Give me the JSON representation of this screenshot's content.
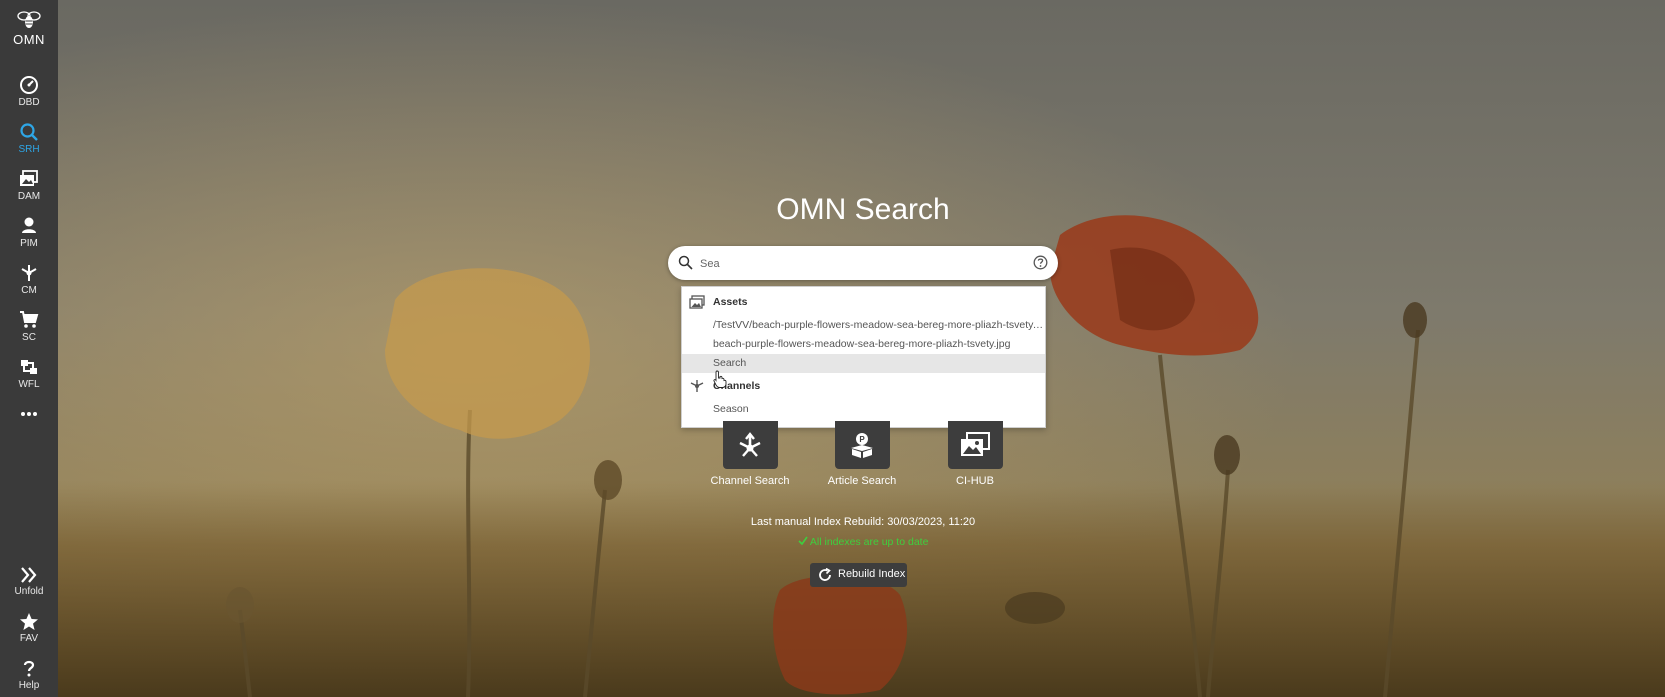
{
  "sidebar": {
    "logo_text": "OMN",
    "items": [
      {
        "icon": "dashboard-icon",
        "label": "DBD"
      },
      {
        "icon": "search-icon",
        "label": "SRH",
        "active": true
      },
      {
        "icon": "image-gallery-icon",
        "label": "DAM"
      },
      {
        "icon": "product-icon",
        "label": "PIM"
      },
      {
        "icon": "channels-icon",
        "label": "CM"
      },
      {
        "icon": "cart-icon",
        "label": "SC"
      },
      {
        "icon": "workflow-icon",
        "label": "WFL"
      },
      {
        "icon": "more-dots-icon",
        "label": ""
      }
    ],
    "bottom_items": [
      {
        "icon": "double-chevron-right-icon",
        "label": "Unfold"
      },
      {
        "icon": "star-icon",
        "label": "FAV"
      },
      {
        "icon": "question-icon",
        "label": "Help"
      }
    ]
  },
  "main": {
    "title": "OMN Search",
    "search": {
      "value": "Sea",
      "placeholder": ""
    },
    "suggestions": {
      "groups": [
        {
          "label": "Assets",
          "icon": "assets-icon",
          "items": [
            "/TestVV/beach-purple-flowers-meadow-sea-bereg-more-pliazh-tsvety.jpg",
            "beach-purple-flowers-meadow-sea-bereg-more-pliazh-tsvety.jpg",
            "Search"
          ]
        },
        {
          "label": "Channels",
          "icon": "channels-icon",
          "items": [
            "Season"
          ]
        }
      ]
    },
    "tiles": [
      {
        "label": "Channel Search",
        "icon": "channel-search-icon"
      },
      {
        "label": "Article Search",
        "icon": "article-search-icon"
      },
      {
        "label": "CI-HUB",
        "icon": "ci-hub-icon"
      }
    ],
    "rebuild_info": "Last manual Index Rebuild: 30/03/2023, 11:20",
    "status": "All indexes are up to date",
    "rebuild_button": "Rebuild Index"
  },
  "colors": {
    "sidebar_bg": "#3a3a3a",
    "active_accent": "#2ea6e6",
    "status_green": "#3ecf3e",
    "tile_bg": "#3d3d3d"
  }
}
